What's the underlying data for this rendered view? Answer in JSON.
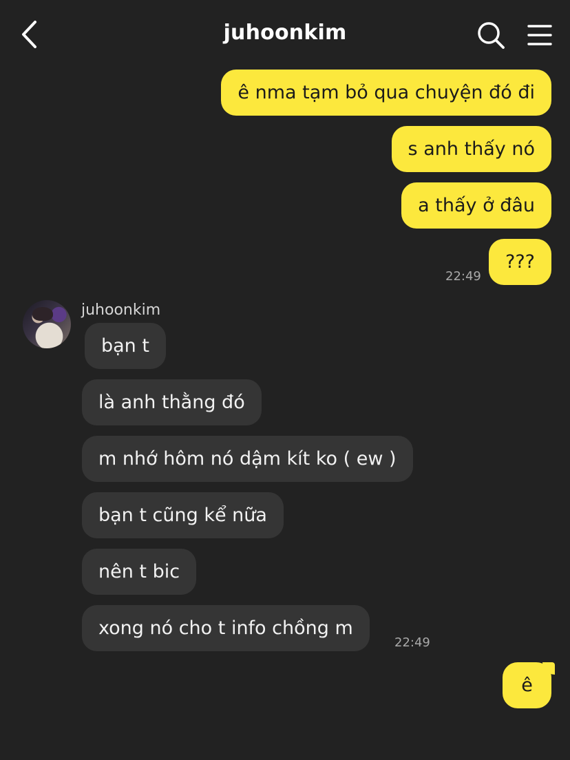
{
  "header": {
    "title": "juhoonkim",
    "back_icon": "chevron-left-icon",
    "search_icon": "search-icon",
    "menu_icon": "hamburger-menu-icon"
  },
  "colors": {
    "background": "#222222",
    "outgoing_bubble": "#fce83d",
    "incoming_bubble": "#353535"
  },
  "messages_out_1": [
    "ê nma tạm bỏ qua chuyện đó đi",
    "s anh thấy nó",
    "a thấy ở đâu",
    "???"
  ],
  "time_out_1": "22:49",
  "sender_name": "juhoonkim",
  "messages_in": [
    "bạn t",
    "là anh thằng đó",
    "m nhớ hôm nó dậm kít ko ( ew )",
    "bạn t cũng kể nữa",
    "nên t bic",
    "xong nó cho t info chồng m"
  ],
  "time_in": "22:49",
  "messages_out_2": [
    "ê"
  ]
}
